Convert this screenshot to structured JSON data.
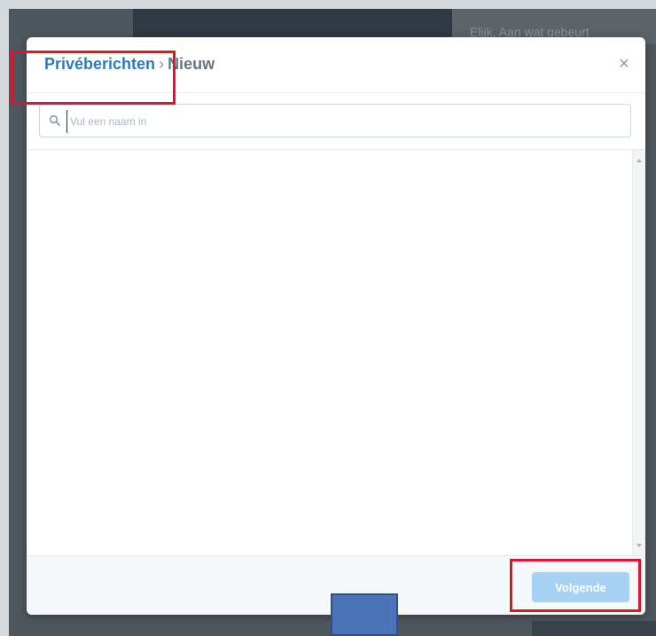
{
  "background": {
    "text": "Elijk, Aan wat gebeurt"
  },
  "modal": {
    "breadcrumb": {
      "root": "Privéberichten",
      "separator": "›",
      "current": "Nieuw"
    },
    "close_icon": "close-icon",
    "search": {
      "placeholder": "Vul een naam in",
      "value": "",
      "icon": "search-icon"
    },
    "footer": {
      "next_label": "Volgende"
    }
  },
  "colors": {
    "link": "#2b7bb9",
    "button_disabled": "#a6d1f2",
    "highlight": "#e0142b",
    "marker": "#4a74b7"
  }
}
